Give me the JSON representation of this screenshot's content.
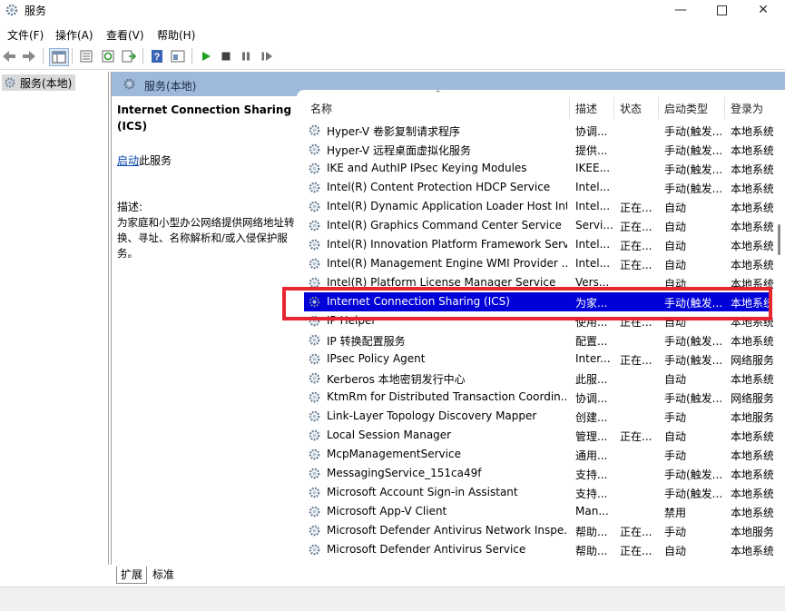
{
  "window": {
    "title": "服务"
  },
  "menu": [
    "文件(F)",
    "操作(A)",
    "查看(V)",
    "帮助(H)"
  ],
  "tree": {
    "item": "服务(本地)"
  },
  "pane": {
    "header": "服务(本地)"
  },
  "description": {
    "title": "Internet Connection Sharing (ICS)",
    "start_link": "启动",
    "start_suffix": "此服务",
    "label": "描述:",
    "text": "为家庭和小型办公网络提供网络地址转换、寻址、名称解析和/或入侵保护服务。"
  },
  "columns": [
    "名称",
    "描述",
    "状态",
    "启动类型",
    "登录为"
  ],
  "services": [
    {
      "name": "Hyper-V 卷影复制请求程序",
      "desc": "协调...",
      "status": "",
      "startup": "手动(触发...",
      "logon": "本地系统"
    },
    {
      "name": "Hyper-V 远程桌面虚拟化服务",
      "desc": "提供...",
      "status": "",
      "startup": "手动(触发...",
      "logon": "本地系统"
    },
    {
      "name": "IKE and AuthIP IPsec Keying Modules",
      "desc": "IKEE...",
      "status": "",
      "startup": "手动(触发...",
      "logon": "本地系统"
    },
    {
      "name": "Intel(R) Content Protection HDCP Service",
      "desc": "Intel...",
      "status": "",
      "startup": "手动(触发...",
      "logon": "本地系统"
    },
    {
      "name": "Intel(R) Dynamic Application Loader Host Int...",
      "desc": "Intel...",
      "status": "正在...",
      "startup": "自动",
      "logon": "本地系统"
    },
    {
      "name": "Intel(R) Graphics Command Center Service",
      "desc": "Servi...",
      "status": "正在...",
      "startup": "自动",
      "logon": "本地系统"
    },
    {
      "name": "Intel(R) Innovation Platform Framework Serv...",
      "desc": "Intel...",
      "status": "正在...",
      "startup": "自动",
      "logon": "本地系统"
    },
    {
      "name": "Intel(R) Management Engine WMI Provider ...",
      "desc": "Intel...",
      "status": "正在...",
      "startup": "自动",
      "logon": "本地系统"
    },
    {
      "name": "Intel(R) Platform License Manager Service",
      "desc": "Vers...",
      "status": "",
      "startup": "自动",
      "logon": "本地系统"
    },
    {
      "name": "Internet Connection Sharing (ICS)",
      "desc": "为家...",
      "status": "",
      "startup": "手动(触发...",
      "logon": "本地系统"
    },
    {
      "name": "IP Helper",
      "desc": "使用...",
      "status": "正在...",
      "startup": "自动",
      "logon": "本地系统"
    },
    {
      "name": "IP 转换配置服务",
      "desc": "配置...",
      "status": "",
      "startup": "手动(触发...",
      "logon": "本地系统"
    },
    {
      "name": "IPsec Policy Agent",
      "desc": "Inter...",
      "status": "正在...",
      "startup": "手动(触发...",
      "logon": "网络服务"
    },
    {
      "name": "Kerberos 本地密钥发行中心",
      "desc": "此服...",
      "status": "",
      "startup": "自动",
      "logon": "本地系统"
    },
    {
      "name": "KtmRm for Distributed Transaction Coordin...",
      "desc": "协调...",
      "status": "",
      "startup": "手动(触发...",
      "logon": "网络服务"
    },
    {
      "name": "Link-Layer Topology Discovery Mapper",
      "desc": "创建...",
      "status": "",
      "startup": "手动",
      "logon": "本地服务"
    },
    {
      "name": "Local Session Manager",
      "desc": "管理...",
      "status": "正在...",
      "startup": "自动",
      "logon": "本地系统"
    },
    {
      "name": "McpManagementService",
      "desc": "通用...",
      "status": "",
      "startup": "手动",
      "logon": "本地系统"
    },
    {
      "name": "MessagingService_151ca49f",
      "desc": "支持...",
      "status": "",
      "startup": "手动(触发...",
      "logon": "本地系统"
    },
    {
      "name": "Microsoft Account Sign-in Assistant",
      "desc": "支持...",
      "status": "",
      "startup": "手动(触发...",
      "logon": "本地系统"
    },
    {
      "name": "Microsoft App-V Client",
      "desc": "Man...",
      "status": "",
      "startup": "禁用",
      "logon": "本地系统"
    },
    {
      "name": "Microsoft Defender Antivirus Network Inspe...",
      "desc": "帮助...",
      "status": "正在...",
      "startup": "手动",
      "logon": "本地服务"
    },
    {
      "name": "Microsoft Defender Antivirus Service",
      "desc": "帮助...",
      "status": "正在...",
      "startup": "自动",
      "logon": "本地系统"
    }
  ],
  "selected_index": 9,
  "tabs": [
    "扩展",
    "标准"
  ],
  "colors": {
    "selection": "#0000d8",
    "header": "#9fb9da",
    "highlight_box": "#e8262f"
  }
}
